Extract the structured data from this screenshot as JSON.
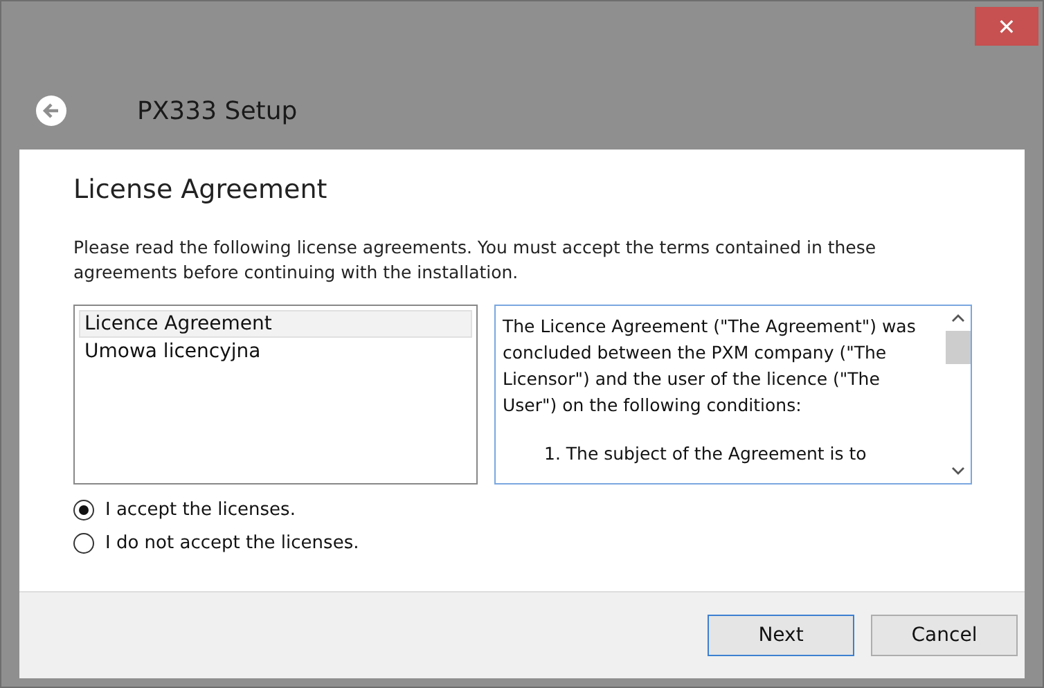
{
  "window": {
    "title": "PX333 Setup",
    "close": "✕"
  },
  "page": {
    "heading": "License Agreement",
    "instructions": "Please read the following license agreements. You must accept the terms contained in these agreements before continuing with the installation."
  },
  "licenses": [
    {
      "label": "Licence Agreement",
      "selected": true
    },
    {
      "label": "Umowa licencyjna",
      "selected": false
    }
  ],
  "agreement_text": [
    {
      "kind": "plain",
      "text": "The Licence Agreement (\"The Agreement\") was concluded between the PXM company (\"The Licensor\") and the user of the licence (\"The User\") on the following conditions:"
    },
    {
      "kind": "indented",
      "text": "1. The subject of the Agreement is to"
    }
  ],
  "options": [
    {
      "label": "I accept the licenses.",
      "selected": true
    },
    {
      "label": "I do not accept the licenses.",
      "selected": false
    }
  ],
  "buttons": [
    {
      "label": "Next",
      "kind": "default"
    },
    {
      "label": "Cancel",
      "kind": "normal"
    }
  ]
}
